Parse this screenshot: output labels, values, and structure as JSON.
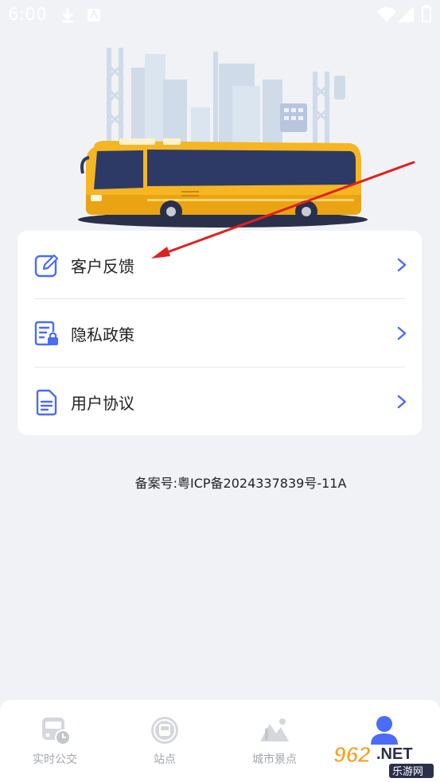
{
  "status_bar": {
    "time": "6:00",
    "icons": [
      "download-icon",
      "notification-a-icon",
      "wifi-icon",
      "signal-icon",
      "battery-icon"
    ]
  },
  "hero": {
    "illustration": "yellow-bus-city-skyline"
  },
  "menu": {
    "items": [
      {
        "label": "客户反馈",
        "icon": "edit-icon"
      },
      {
        "label": "隐私政策",
        "icon": "document-lock-icon"
      },
      {
        "label": "用户协议",
        "icon": "document-icon"
      }
    ]
  },
  "icp": "备案号:粤ICP备2024337839号-11A",
  "annotation": {
    "type": "red-arrow",
    "points_to": "客户反馈"
  },
  "bottom_nav": {
    "active_index": 3,
    "items": [
      {
        "label": "实时公交",
        "icon": "bus-clock-icon"
      },
      {
        "label": "站点",
        "icon": "bus-stop-icon"
      },
      {
        "label": "城市景点",
        "icon": "mountain-icon"
      },
      {
        "label": "",
        "icon": "user-icon"
      }
    ]
  },
  "watermark": {
    "text": "962.NET",
    "subtext": "乐游网"
  },
  "colors": {
    "accent": "#4a6cf7",
    "background": "#f1f2f6",
    "bus_yellow": "#f6b622",
    "arrow_red": "#e02020",
    "inactive": "#a3a6ae"
  }
}
